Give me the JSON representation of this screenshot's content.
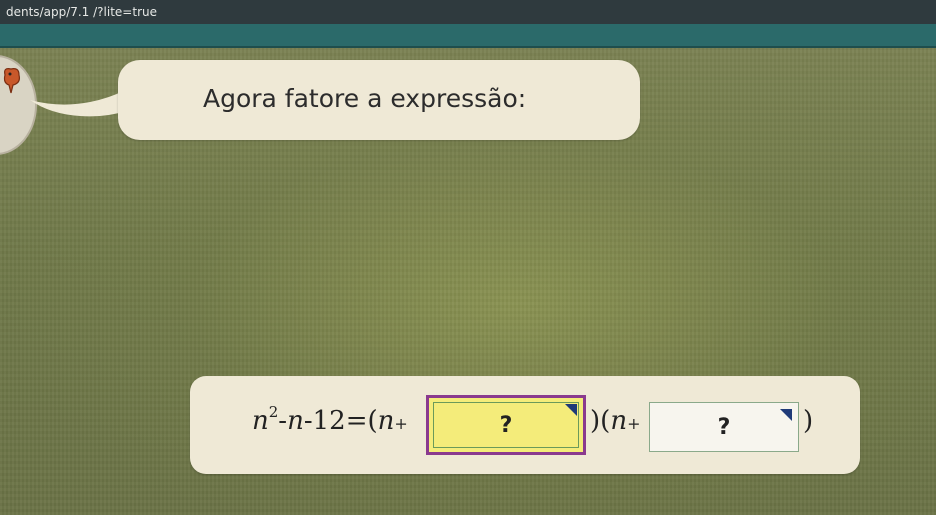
{
  "browser": {
    "url_fragment": "dents/app/7.1  /?lite=true"
  },
  "prompt": {
    "text": "Agora fatore a expressão:"
  },
  "equation": {
    "lhs_var": "n",
    "lhs_exp": "2",
    "lhs_rest1": "-",
    "lhs_var2": "n",
    "lhs_rest2": "-12=",
    "open1": "(",
    "var1": "n",
    "plus1": "+",
    "box1_value": "?",
    "close1": ")",
    "open2": "(",
    "var2": "n",
    "plus2": "+",
    "box2_value": "?",
    "close2": ")"
  },
  "colors": {
    "board": "#6b7442",
    "bubble": "#efe9d6",
    "active_box_fill": "#f4ec7a",
    "active_box_border": "#8a3a8e",
    "dropdown_marker": "#1f3a78"
  }
}
